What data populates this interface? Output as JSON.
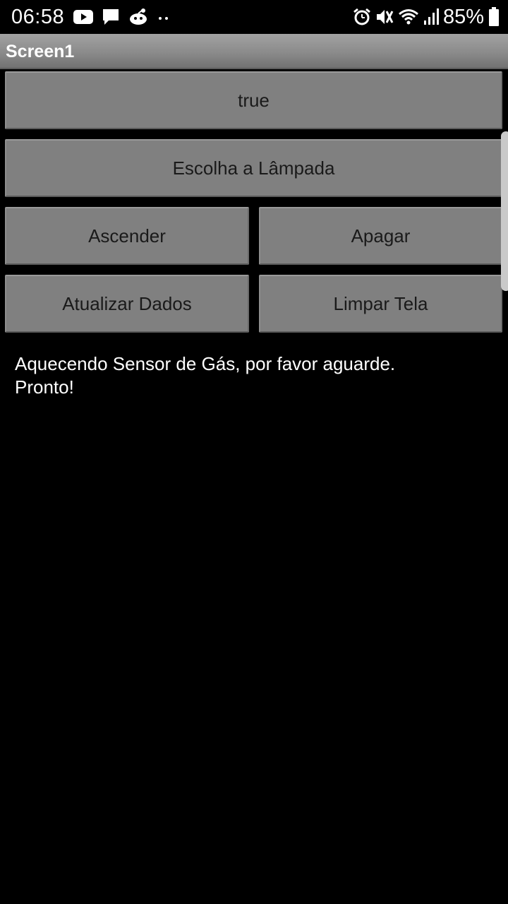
{
  "status_bar": {
    "time": "06:58",
    "battery": "85%",
    "left_icons": [
      "youtube-icon",
      "message-icon",
      "reddit-icon",
      "more-dots-icon"
    ],
    "right_icons": [
      "alarm-icon",
      "mute-icon",
      "wifi-icon",
      "signal-icon",
      "battery-icon"
    ]
  },
  "title_bar": {
    "title": "Screen1"
  },
  "buttons": {
    "status_label": "true",
    "choose_lamp_label": "Escolha a Lâmpada",
    "turn_on_label": "Ascender",
    "turn_off_label": "Apagar",
    "update_data_label": "Atualizar Dados",
    "clear_screen_label": "Limpar Tela"
  },
  "log": {
    "lines": [
      "Aquecendo Sensor de Gás, por favor aguarde.",
      "Pronto!"
    ]
  },
  "colors": {
    "background": "#000000",
    "button": "#808080",
    "button_text": "#1a1a1a",
    "title_bar": "#8b8b8b",
    "text": "#ffffff"
  }
}
